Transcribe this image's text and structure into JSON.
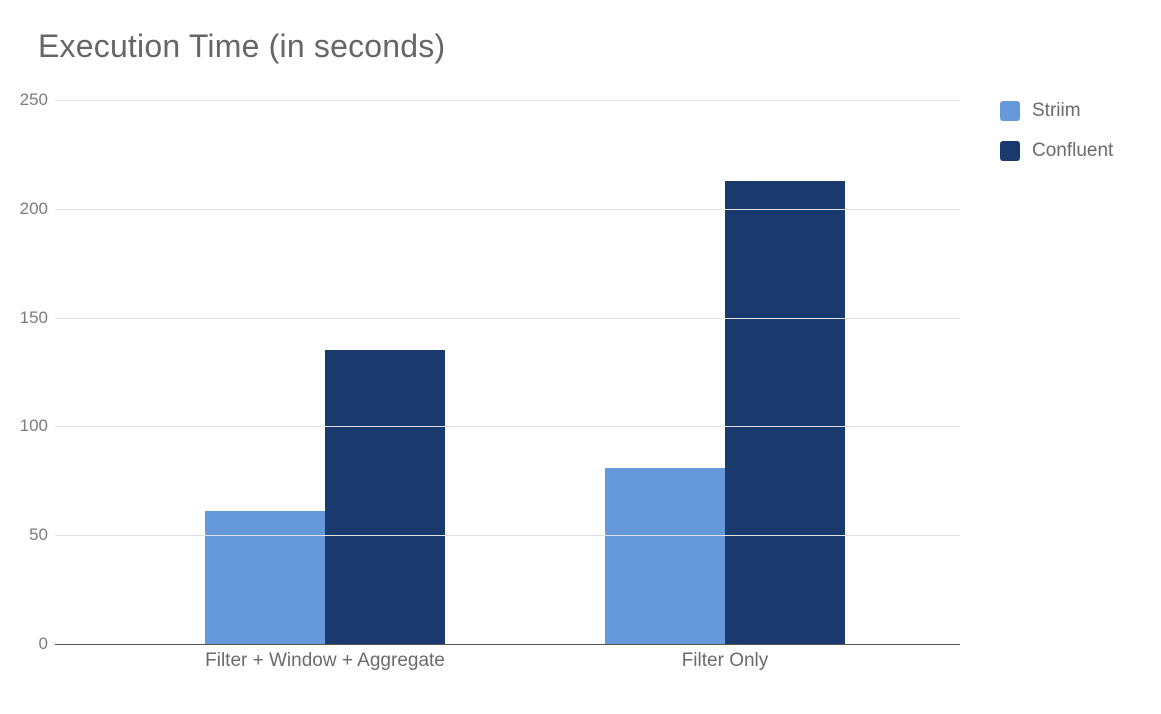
{
  "chart_data": {
    "type": "bar",
    "title": "Execution Time (in seconds)",
    "categories": [
      "Filter + Window + Aggregate",
      "Filter Only"
    ],
    "series": [
      {
        "name": "Striim",
        "values": [
          61,
          81
        ],
        "color": "#6699d9"
      },
      {
        "name": "Confluent",
        "values": [
          135,
          213
        ],
        "color": "#1a3a6e"
      }
    ],
    "xlabel": "",
    "ylabel": "",
    "ylim": [
      0,
      250
    ],
    "yticks": [
      0,
      50,
      100,
      150,
      200,
      250
    ],
    "grid": true,
    "legend_position": "right"
  }
}
